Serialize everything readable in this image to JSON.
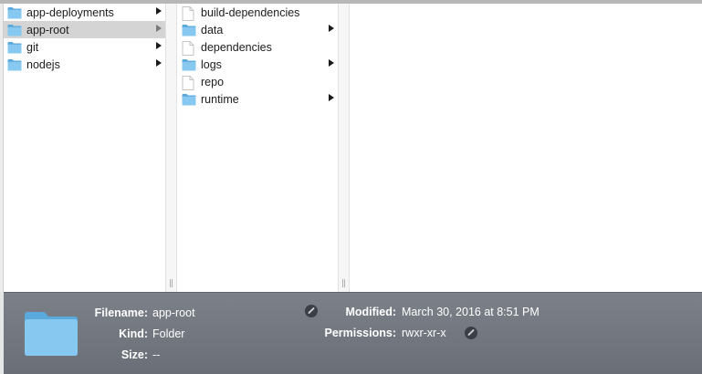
{
  "columns": {
    "col1": {
      "items": [
        {
          "label": "app-deployments",
          "type": "folder",
          "has_children": true,
          "selected": false
        },
        {
          "label": "app-root",
          "type": "folder",
          "has_children": true,
          "selected": true
        },
        {
          "label": "git",
          "type": "folder",
          "has_children": true,
          "selected": false
        },
        {
          "label": "nodejs",
          "type": "folder",
          "has_children": true,
          "selected": false
        }
      ]
    },
    "col2": {
      "items": [
        {
          "label": "build-dependencies",
          "type": "file",
          "has_children": false
        },
        {
          "label": "data",
          "type": "folder",
          "has_children": true
        },
        {
          "label": "dependencies",
          "type": "file",
          "has_children": false
        },
        {
          "label": "logs",
          "type": "folder",
          "has_children": true
        },
        {
          "label": "repo",
          "type": "file",
          "has_children": false
        },
        {
          "label": "runtime",
          "type": "folder",
          "has_children": true
        }
      ]
    }
  },
  "divider_grip": "||",
  "info": {
    "filename_label": "Filename:",
    "filename_value": "app-root",
    "kind_label": "Kind:",
    "kind_value": "Folder",
    "size_label": "Size:",
    "size_value": "--",
    "modified_label": "Modified:",
    "modified_value": "March 30, 2016 at 8:51 PM",
    "permissions_label": "Permissions:",
    "permissions_value": "rwxr-xr-x"
  },
  "colors": {
    "folder": "#7cc3ee",
    "selection": "#d4d4d4",
    "info_panel": "#747981"
  },
  "icons": {
    "folder": "folder-icon",
    "file": "file-icon",
    "arrow": "chevron-right-icon",
    "edit": "pencil-icon"
  }
}
